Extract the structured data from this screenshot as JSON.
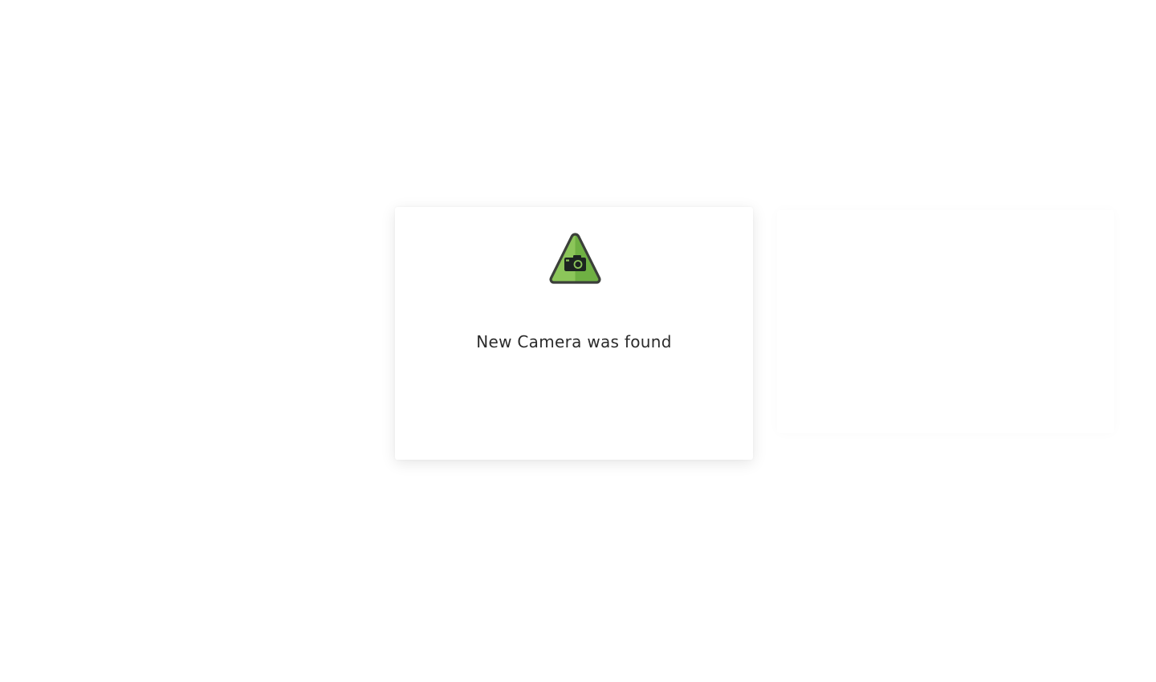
{
  "dialog": {
    "icon": "camera-warning-icon",
    "message": "New Camera was found"
  },
  "colors": {
    "icon_green_light": "#8cc65a",
    "icon_green_dark": "#6fb043",
    "icon_outline": "#3b3f3a",
    "camera_body": "#1c2420",
    "text": "#2b2b2b",
    "background": "#ffffff"
  }
}
